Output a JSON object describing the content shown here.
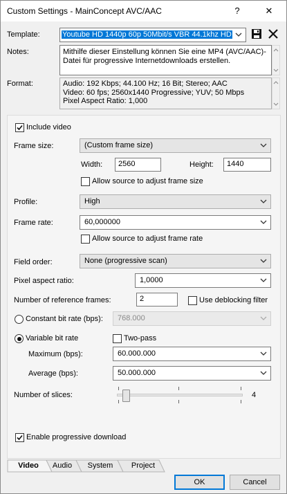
{
  "window": {
    "title": "Custom Settings - MainConcept AVC/AAC",
    "help": "?",
    "close": "✕"
  },
  "header": {
    "template_label": "Template:",
    "template_value": "Youtube HD 1440p 60p 50Mbit/s VBR 44.1khz HD",
    "notes_label": "Notes:",
    "notes_text": "Mithilfe dieser Einstellung können Sie eine MP4 (AVC/AAC)-Datei für progressive Internetdownloads erstellen.",
    "format_label": "Format:",
    "format_lines": [
      "Audio: 192 Kbps; 44.100 Hz; 16 Bit; Stereo; AAC",
      "Video: 60 fps; 2560x1440 Progressive; YUV; 50 Mbps",
      "Pixel Aspect Ratio: 1,000"
    ]
  },
  "video": {
    "include_video": {
      "label": "Include video",
      "checked": true
    },
    "frame_size": {
      "label": "Frame size:",
      "value": "(Custom frame size)"
    },
    "width": {
      "label": "Width:",
      "value": "2560"
    },
    "height": {
      "label": "Height:",
      "value": "1440"
    },
    "allow_source_frame_size": {
      "label": "Allow source to adjust frame size",
      "checked": false
    },
    "profile": {
      "label": "Profile:",
      "value": "High"
    },
    "frame_rate": {
      "label": "Frame rate:",
      "value": "60,000000"
    },
    "allow_source_frame_rate": {
      "label": "Allow source to adjust frame rate",
      "checked": false
    },
    "field_order": {
      "label": "Field order:",
      "value": "None (progressive scan)"
    },
    "pixel_aspect": {
      "label": "Pixel aspect ratio:",
      "value": "1,0000"
    },
    "ref_frames": {
      "label": "Number of reference frames:",
      "value": "2"
    },
    "deblocking": {
      "label": "Use deblocking filter",
      "checked": false
    },
    "cbr": {
      "label": "Constant bit rate (bps):",
      "value": "768.000",
      "selected": false
    },
    "vbr": {
      "label": "Variable bit rate",
      "selected": true
    },
    "two_pass": {
      "label": "Two-pass",
      "checked": false
    },
    "maximum": {
      "label": "Maximum (bps):",
      "value": "60.000.000"
    },
    "average": {
      "label": "Average (bps):",
      "value": "50.000.000"
    },
    "slices": {
      "label": "Number of slices:",
      "value": "4",
      "level": 0.0
    },
    "progressive_download": {
      "label": "Enable progressive download",
      "checked": true
    }
  },
  "tabs": [
    "Video",
    "Audio",
    "System",
    "Project"
  ],
  "buttons": {
    "ok": "OK",
    "cancel": "Cancel"
  },
  "colors": {
    "accent": "#0078d7",
    "selection": "#0078d7"
  }
}
